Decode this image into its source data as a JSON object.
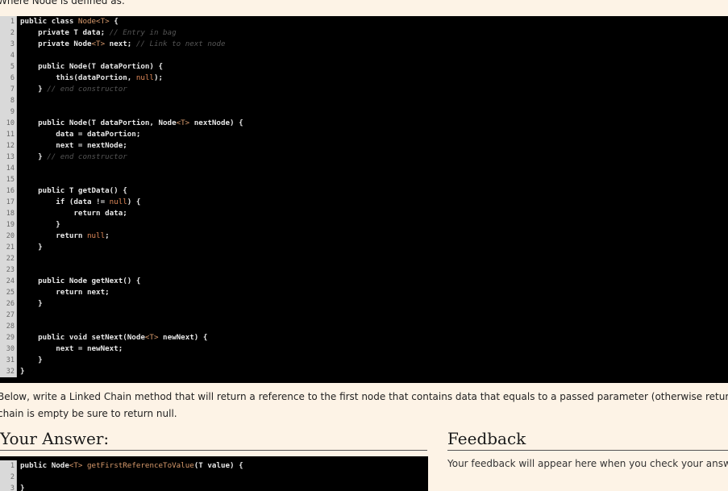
{
  "intro_text": "Where Node is defined as:",
  "node_code": [
    {
      "n": "1",
      "segs": [
        [
          "public class ",
          "t"
        ],
        [
          "Node<T>",
          "g"
        ],
        [
          " {",
          "t"
        ]
      ]
    },
    {
      "n": "2",
      "segs": [
        [
          "    private T data; ",
          "t"
        ],
        [
          "// Entry in bag",
          "c"
        ]
      ]
    },
    {
      "n": "3",
      "segs": [
        [
          "    private Node",
          "t"
        ],
        [
          "<T>",
          "g"
        ],
        [
          " next; ",
          "t"
        ],
        [
          "// Link to next node",
          "c"
        ]
      ]
    },
    {
      "n": "4",
      "segs": []
    },
    {
      "n": "5",
      "segs": [
        [
          "    public Node(T dataPortion) {",
          "t"
        ]
      ]
    },
    {
      "n": "6",
      "segs": [
        [
          "        this(dataPortion, ",
          "t"
        ],
        [
          "null",
          "l"
        ],
        [
          ");",
          "t"
        ]
      ]
    },
    {
      "n": "7",
      "segs": [
        [
          "    } ",
          "t"
        ],
        [
          "// end constructor",
          "c"
        ]
      ]
    },
    {
      "n": "8",
      "segs": []
    },
    {
      "n": "9",
      "segs": []
    },
    {
      "n": "10",
      "segs": [
        [
          "    public Node(T dataPortion, Node",
          "t"
        ],
        [
          "<T>",
          "g"
        ],
        [
          " nextNode) {",
          "t"
        ]
      ]
    },
    {
      "n": "11",
      "segs": [
        [
          "        data = dataPortion;",
          "t"
        ]
      ]
    },
    {
      "n": "12",
      "segs": [
        [
          "        next = nextNode;",
          "t"
        ]
      ]
    },
    {
      "n": "13",
      "segs": [
        [
          "    } ",
          "t"
        ],
        [
          "// end constructor",
          "c"
        ]
      ]
    },
    {
      "n": "14",
      "segs": []
    },
    {
      "n": "15",
      "segs": []
    },
    {
      "n": "16",
      "segs": [
        [
          "    public T getData() {",
          "t"
        ]
      ]
    },
    {
      "n": "17",
      "segs": [
        [
          "        if (data != ",
          "t"
        ],
        [
          "null",
          "l"
        ],
        [
          ") {",
          "t"
        ]
      ]
    },
    {
      "n": "18",
      "segs": [
        [
          "            return data;",
          "t"
        ]
      ]
    },
    {
      "n": "19",
      "segs": [
        [
          "        }",
          "t"
        ]
      ]
    },
    {
      "n": "20",
      "segs": [
        [
          "        return ",
          "t"
        ],
        [
          "null",
          "l"
        ],
        [
          ";",
          "t"
        ]
      ]
    },
    {
      "n": "21",
      "segs": [
        [
          "    }",
          "t"
        ]
      ]
    },
    {
      "n": "22",
      "segs": []
    },
    {
      "n": "23",
      "segs": []
    },
    {
      "n": "24",
      "segs": [
        [
          "    public Node getNext() {",
          "t"
        ]
      ]
    },
    {
      "n": "25",
      "segs": [
        [
          "        return next;",
          "t"
        ]
      ]
    },
    {
      "n": "26",
      "segs": [
        [
          "    }",
          "t"
        ]
      ]
    },
    {
      "n": "27",
      "segs": []
    },
    {
      "n": "28",
      "segs": []
    },
    {
      "n": "29",
      "segs": [
        [
          "    public void setNext(Node",
          "t"
        ],
        [
          "<T>",
          "g"
        ],
        [
          " newNext) {",
          "t"
        ]
      ]
    },
    {
      "n": "30",
      "segs": [
        [
          "        next = newNext;",
          "t"
        ]
      ]
    },
    {
      "n": "31",
      "segs": [
        [
          "    }",
          "t"
        ]
      ]
    },
    {
      "n": "32",
      "segs": [
        [
          "}",
          "t"
        ]
      ]
    }
  ],
  "prompt_lines": [
    "Below, write a Linked Chain method that will return a reference to the first node that contains data that equals to a passed parameter (otherwise return null). If the linked",
    "chain is empty be sure to return null."
  ],
  "answer_heading": "Your Answer:",
  "feedback_heading": "Feedback",
  "answer_code": [
    {
      "n": "1",
      "segs": [
        [
          "public Node",
          "t"
        ],
        [
          "<T>",
          "g"
        ],
        [
          " getFirstReferenceToValue",
          "g"
        ],
        [
          "(T value) {",
          "t"
        ]
      ]
    },
    {
      "n": "2",
      "segs": []
    },
    {
      "n": "3",
      "segs": [
        [
          "}",
          "t"
        ]
      ]
    }
  ],
  "feedback_text": "Your feedback will appear here when you check your answer."
}
